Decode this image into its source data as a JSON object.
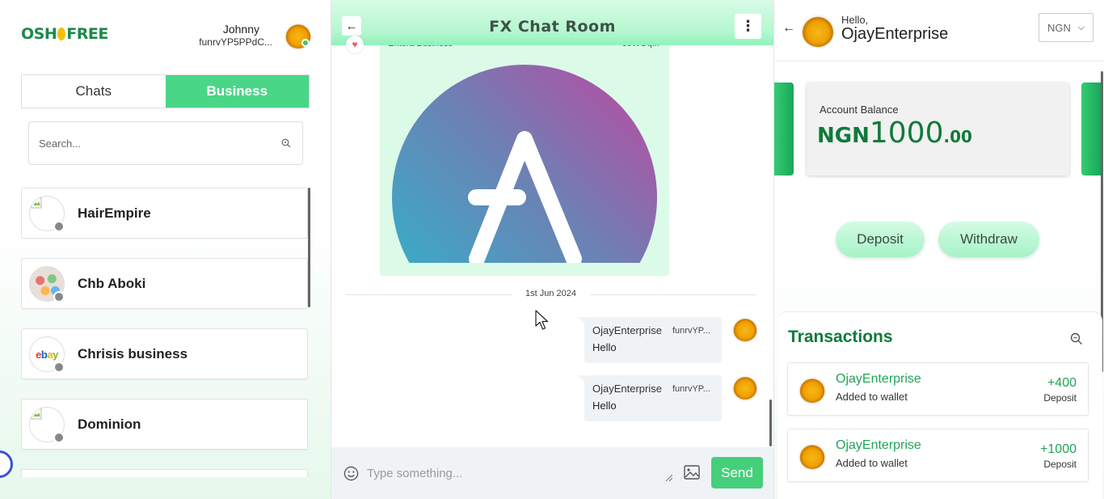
{
  "brand": {
    "logo": "OSHOFREE",
    "logo_left": "OSH",
    "logo_right": "FREE"
  },
  "user": {
    "name": "Johnny",
    "id": "funrvYP5PPdC..."
  },
  "tabs": [
    {
      "label": "Chats"
    },
    {
      "label": "Business",
      "active": true
    }
  ],
  "search": {
    "placeholder": "Search..."
  },
  "chat_list": [
    {
      "name": "HairEmpire",
      "status": "offline"
    },
    {
      "name": "Chb Aboki",
      "status": "offline"
    },
    {
      "name": "Chrisis business",
      "status": "offline",
      "avatar_text": "ebay"
    },
    {
      "name": "Dominion",
      "status": "offline"
    }
  ],
  "room": {
    "title": "FX Chat Room",
    "media_card": {
      "sender_cut": "Entera Business",
      "id_cut": "JoWOq..."
    },
    "date_separator": "1st Jun 2024",
    "messages": [
      {
        "from": "OjayEnterprise",
        "from_id": "funrvYP...",
        "text": "Hello"
      },
      {
        "from": "OjayEnterprise",
        "from_id": "funrvYP...",
        "text": "Hello"
      }
    ],
    "input": {
      "placeholder": "Type something..."
    },
    "send_label": "Send"
  },
  "wallet": {
    "greeting": "Hello,",
    "business_name": "OjayEnterprise",
    "currency_select": "NGN",
    "balance_label": "Account Balance",
    "balance_currency": "NGN",
    "balance_whole": "1000",
    "balance_decimal": ".00",
    "deposit_label": "Deposit",
    "withdraw_label": "Withdraw",
    "transactions_title": "Transactions",
    "transactions": [
      {
        "name": "OjayEnterprise",
        "desc": "Added to wallet",
        "amount": "+400",
        "type": "Deposit"
      },
      {
        "name": "OjayEnterprise",
        "desc": "Added to wallet",
        "amount": "+1000",
        "type": "Deposit"
      }
    ]
  },
  "colors": {
    "accent": "#4ad687",
    "brand_green": "#0f7a3a",
    "header_mint": "#b5f7cf"
  }
}
